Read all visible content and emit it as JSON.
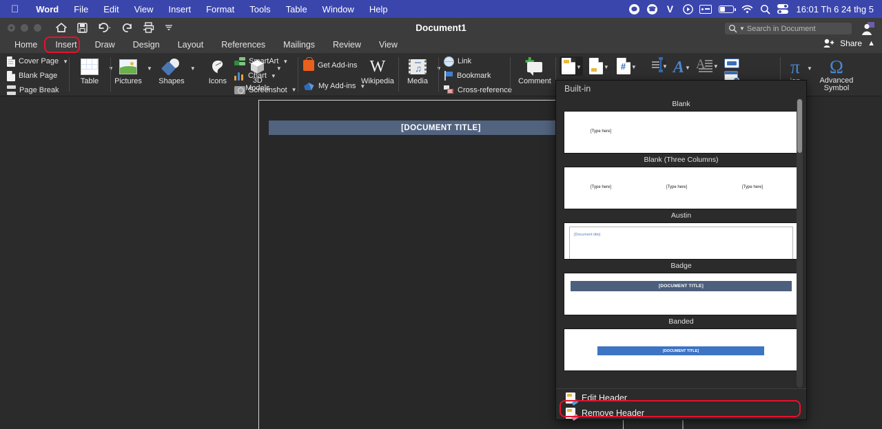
{
  "macbar": {
    "apple_icon": "apple-logo",
    "menus": [
      {
        "label": "Word",
        "bold": true
      },
      {
        "label": "File",
        "bold": false
      },
      {
        "label": "Edit",
        "bold": false
      },
      {
        "label": "View",
        "bold": false
      },
      {
        "label": "Insert",
        "bold": false
      },
      {
        "label": "Format",
        "bold": false
      },
      {
        "label": "Tools",
        "bold": false
      },
      {
        "label": "Table",
        "bold": false
      },
      {
        "label": "Window",
        "bold": false
      },
      {
        "label": "Help",
        "bold": false
      }
    ],
    "status_icons": [
      {
        "name": "line-messenger-icon",
        "glyph": "●"
      },
      {
        "name": "viber-icon",
        "glyph": "☎"
      },
      {
        "name": "vpn-v-icon",
        "glyph": "V"
      },
      {
        "name": "play-circle-icon",
        "glyph": "▶"
      },
      {
        "name": "contact-card-icon",
        "glyph": ""
      },
      {
        "name": "battery-icon",
        "glyph": ""
      },
      {
        "name": "wifi-icon",
        "glyph": ""
      },
      {
        "name": "spotlight-search-icon",
        "glyph": ""
      },
      {
        "name": "control-center-icon",
        "glyph": ""
      }
    ],
    "clock": "16:01 Th 6 24 thg 5",
    "bar_color": "#3b46ad"
  },
  "titlebar": {
    "document_title": "Document1",
    "quick_access": [
      {
        "name": "home-icon",
        "label": "Home"
      },
      {
        "name": "save-icon",
        "label": "Save"
      },
      {
        "name": "undo-icon",
        "label": "Undo"
      },
      {
        "name": "redo-icon",
        "label": "Redo"
      },
      {
        "name": "print-icon",
        "label": "Print"
      },
      {
        "name": "customize-toolbar-icon",
        "label": "Customize"
      }
    ],
    "search_placeholder": "Search in Document",
    "share_label": "Share",
    "collapse_ribbon_icon": "chevron-up-icon"
  },
  "ribbon_tabs": {
    "items": [
      "Home",
      "Insert",
      "Draw",
      "Design",
      "Layout",
      "References",
      "Mailings",
      "Review",
      "View"
    ],
    "active": "Insert",
    "highlight_color": "#e8112d"
  },
  "ribbon": {
    "pages_group": [
      {
        "label": "Cover Page",
        "has_caret": true,
        "icon": "cover-page-icon"
      },
      {
        "label": "Blank Page",
        "has_caret": false,
        "icon": "blank-page-icon"
      },
      {
        "label": "Page Break",
        "has_caret": false,
        "icon": "page-break-icon"
      }
    ],
    "table_group": [
      {
        "label": "Table",
        "icon": "table-icon",
        "has_caret": true
      }
    ],
    "illustrations_group": [
      {
        "label": "Pictures",
        "icon": "pictures-icon",
        "has_caret": true
      },
      {
        "label": "Shapes",
        "icon": "shapes-icon",
        "has_caret": true
      },
      {
        "label": "Icons",
        "icon": "icons-icon",
        "has_caret": false
      },
      {
        "label": "3D\nModels",
        "label_line1": "3D",
        "label_line2": "Models",
        "icon": "three-d-models-icon",
        "has_caret": true
      }
    ],
    "smartart_group": [
      {
        "label": "SmartArt",
        "has_caret": true,
        "icon": "smartart-icon"
      },
      {
        "label": "Chart",
        "has_caret": true,
        "icon": "chart-icon"
      },
      {
        "label": "Screenshot",
        "has_caret": true,
        "icon": "screenshot-icon"
      }
    ],
    "addins_group": [
      {
        "label": "Get Add-ins",
        "has_caret": false,
        "icon": "get-addins-icon"
      },
      {
        "label": "My Add-ins",
        "has_caret": true,
        "icon": "my-addins-icon"
      }
    ],
    "wikipedia": {
      "label": "Wikipedia",
      "icon": "wikipedia-icon"
    },
    "media": {
      "label": "Media",
      "icon": "media-icon",
      "has_caret": true
    },
    "links_group": [
      {
        "label": "Link",
        "icon": "link-icon"
      },
      {
        "label": "Bookmark",
        "icon": "bookmark-icon"
      },
      {
        "label": "Cross-reference",
        "icon": "cross-reference-icon"
      }
    ],
    "comment": {
      "label": "Comment",
      "icon": "comment-icon"
    },
    "header_footer_group": [
      {
        "name": "header-button",
        "icon": "header-icon",
        "active": true
      },
      {
        "name": "footer-button",
        "icon": "footer-icon",
        "active": false
      },
      {
        "name": "page-number-button",
        "icon": "page-number-icon",
        "active": false
      }
    ],
    "text_group": [
      {
        "name": "text-box-button",
        "icon": "text-box-icon"
      },
      {
        "name": "wordart-button",
        "icon": "wordart-icon"
      },
      {
        "name": "drop-cap-button",
        "icon": "drop-cap-icon"
      },
      {
        "name": "field-button",
        "icon": "field-icon"
      },
      {
        "name": "date-time-button",
        "icon": "date-time-icon"
      }
    ],
    "symbols_group": [
      {
        "label": "ion",
        "full_label": "Equation",
        "icon": "equation-icon",
        "has_caret": true
      },
      {
        "label_line1": "Advanced",
        "label_line2": "Symbol",
        "icon": "advanced-symbol-icon",
        "has_caret": false
      }
    ]
  },
  "document": {
    "header_text": "[DOCUMENT TITLE]",
    "header_bar_color": "#52637f"
  },
  "gallery": {
    "section_label": "Built-in",
    "items": [
      {
        "label": "Blank",
        "kind": "blank",
        "placeholders": [
          "[Type here]"
        ]
      },
      {
        "label": "Blank (Three Columns)",
        "kind": "three-columns",
        "placeholders": [
          "[Type here]",
          "[Type here]",
          "[Type here]"
        ]
      },
      {
        "label": "Austin",
        "kind": "austin",
        "title": "[Document title]"
      },
      {
        "label": "Badge",
        "kind": "badge",
        "title": "[DOCUMENT TITLE]"
      },
      {
        "label": "Banded",
        "kind": "banded",
        "title": "[DOCUMENT TITLE]"
      }
    ],
    "actions": [
      {
        "label": "Edit Header",
        "icon": "edit-header-icon",
        "highlighted": false
      },
      {
        "label": "Remove Header",
        "icon": "remove-header-icon",
        "highlighted": true
      }
    ],
    "highlight_color": "#e8112d"
  }
}
